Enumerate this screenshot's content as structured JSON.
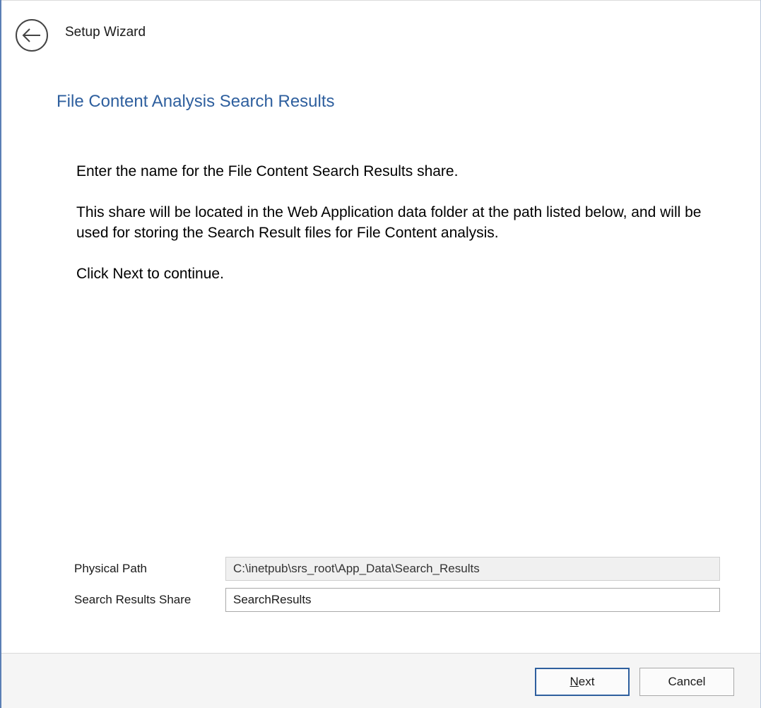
{
  "window": {
    "title": "Setup Wizard",
    "back_icon": "back-arrow-icon"
  },
  "page": {
    "heading": "File Content Analysis Search Results",
    "paragraphs": [
      "Enter the name for the File Content Search Results share.",
      "This share will be located in the Web Application data folder at the path listed below, and will be used for storing the Search Result files for File Content analysis.",
      "Click Next to continue."
    ]
  },
  "form": {
    "physical_path": {
      "label": "Physical Path",
      "value": "C:\\inetpub\\srs_root\\App_Data\\Search_Results"
    },
    "search_results_share": {
      "label": "Search Results Share",
      "value": "SearchResults"
    }
  },
  "footer": {
    "next_label_accel": "N",
    "next_label_rest": "ext",
    "cancel_label": "Cancel"
  },
  "colors": {
    "accent": "#2e5f9e",
    "window_border": "#5b7fb5",
    "footer_bg": "#f5f5f5"
  }
}
